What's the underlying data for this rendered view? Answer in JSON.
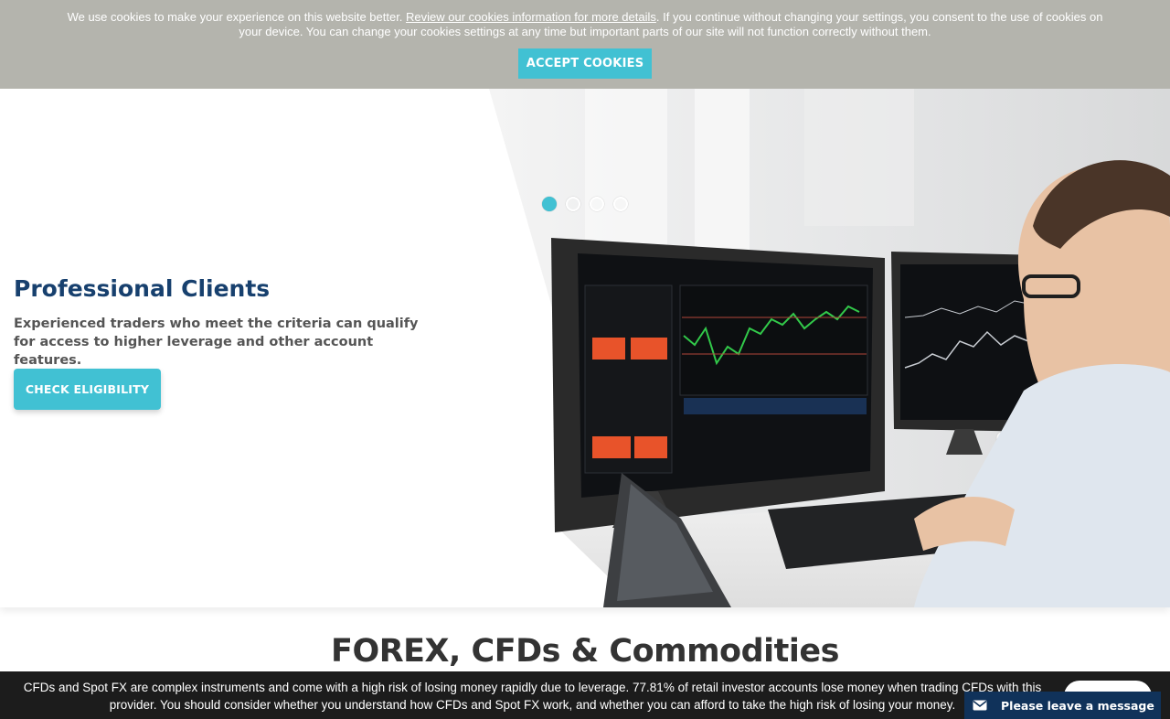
{
  "cookie_banner": {
    "text_before_link": "We use cookies to make your experience on this website better. ",
    "link_text": "Review our cookies information for more details",
    "text_after_link": ". If you continue without changing your settings, you consent to the use of cookies on your device. You can change your cookies settings at any time but important parts of our site will not function correctly without them.",
    "accept_label": "ACCEPT COOKIES"
  },
  "hero": {
    "title": "Professional Clients",
    "description": "Experienced traders who meet the criteria can qualify for access to higher leverage and other account features.",
    "button_label": "CHECK ELIGIBILITY",
    "slides_count": 4,
    "active_slide": 1
  },
  "section": {
    "heading": "FOREX, CFDs & Commodities"
  },
  "risk_warning": {
    "text": "CFDs and Spot FX are complex instruments and come with a high risk of losing money rapidly due to leverage. 77.81% of retail investor accounts lose money when trading CFDs with this provider. You should consider whether you understand how CFDs and Spot FX work, and whether you can afford to take the high risk of losing your money."
  },
  "chat": {
    "label": "Please leave a message",
    "icon": "envelope-icon"
  },
  "colors": {
    "accent": "#41c1d3",
    "title_navy": "#17406e",
    "cookie_bg": "#b4b4ad",
    "risk_bg": "#1c1c1c",
    "chat_bg": "#10325a"
  }
}
